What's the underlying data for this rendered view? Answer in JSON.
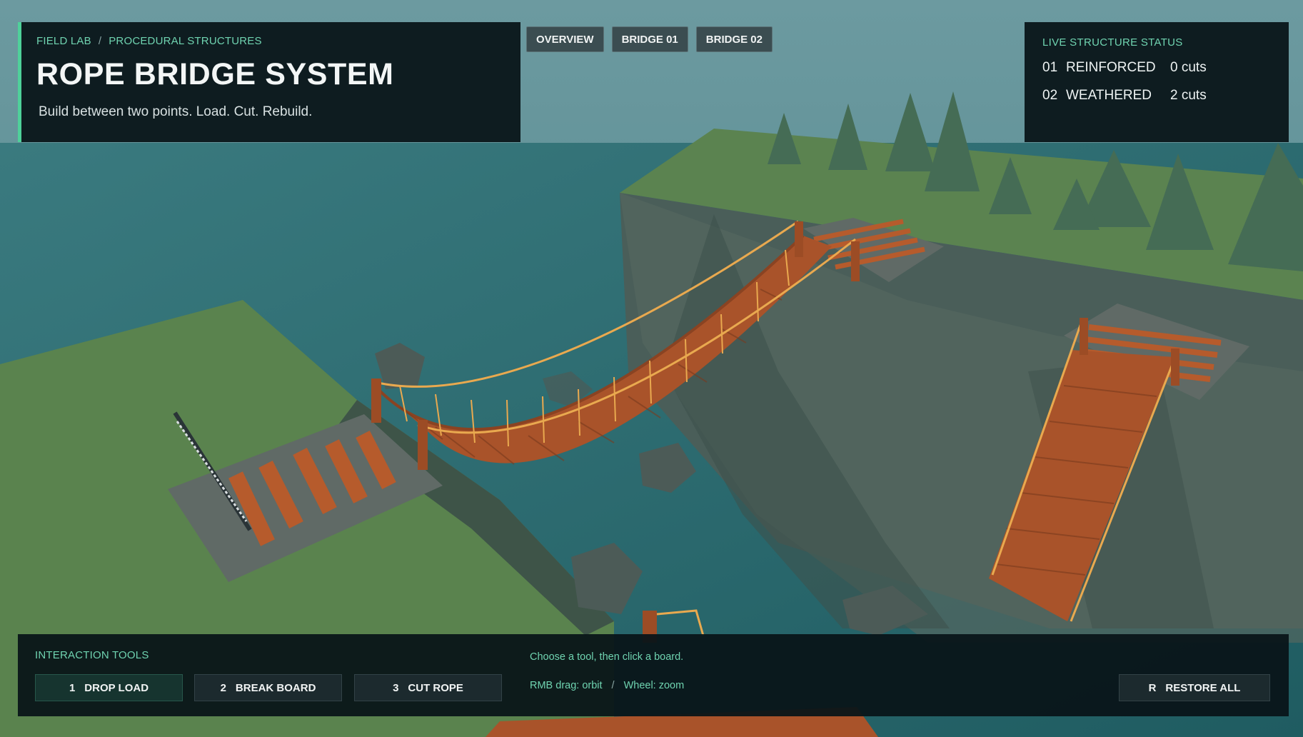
{
  "header": {
    "breadcrumb": [
      "FIELD LAB",
      "PROCEDURAL STRUCTURES"
    ],
    "breadcrumb_separator": "/",
    "title": "ROPE BRIDGE SYSTEM",
    "subtitle": "Build between two points. Load. Cut. Rebuild."
  },
  "tabs": [
    {
      "label": "OVERVIEW"
    },
    {
      "label": "BRIDGE 01"
    },
    {
      "label": "BRIDGE 02"
    }
  ],
  "status": {
    "title": "LIVE STRUCTURE STATUS",
    "rows": [
      {
        "id": "01",
        "state": "REINFORCED",
        "cuts": "0 cuts"
      },
      {
        "id": "02",
        "state": "WEATHERED",
        "cuts": "2 cuts"
      }
    ]
  },
  "tools": {
    "title": "INTERACTION TOOLS",
    "buttons": [
      {
        "key": "1",
        "label": "DROP LOAD"
      },
      {
        "key": "2",
        "label": "BREAK BOARD"
      },
      {
        "key": "3",
        "label": "CUT ROPE"
      }
    ],
    "restore": {
      "key": "R",
      "label": "RESTORE ALL"
    },
    "hint": "Choose a tool, then click a board.",
    "controls": [
      "RMB drag: orbit",
      "Wheel: zoom"
    ],
    "controls_separator": "/"
  },
  "colors": {
    "accent": "#4fd19a",
    "accent_text": "#6fd3b0",
    "panel": "#091418",
    "water": "#2d6d72",
    "grass": "#587f4c",
    "wood": "#b5592c",
    "rope": "#e9a94f"
  }
}
